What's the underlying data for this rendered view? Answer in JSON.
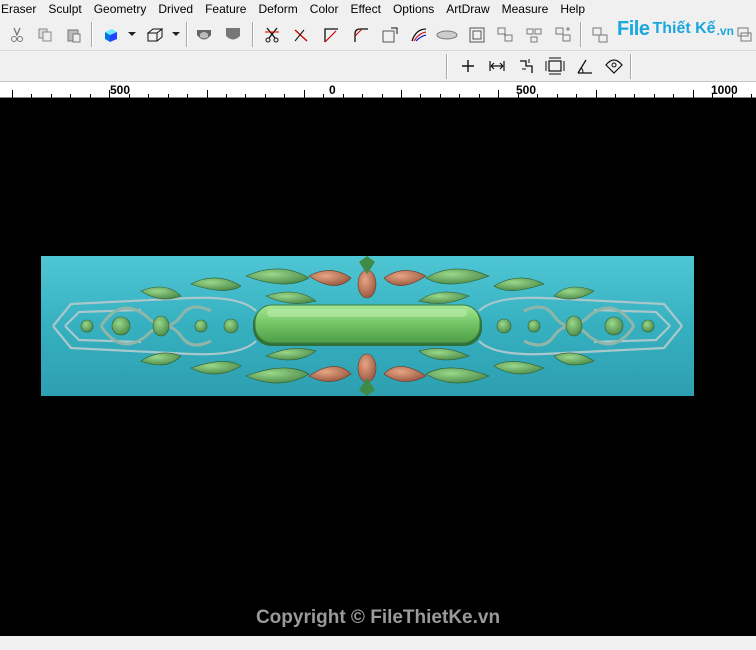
{
  "menu": [
    "Eraser",
    "Sculpt",
    "Geometry",
    "Drived",
    "Feature",
    "Deform",
    "Color",
    "Effect",
    "Options",
    "ArtDraw",
    "Measure",
    "Help"
  ],
  "logo": {
    "file": "File",
    "rest": "Thiết Kế",
    "tld": ".vn"
  },
  "ruler": {
    "labels": [
      "500",
      "0",
      "500",
      "1000"
    ]
  },
  "copyright": "Copyright © FileThietKe.vn",
  "colors": {
    "background": "#000000",
    "panel_cyan": "#3fb8c6",
    "ornament_green": "#5cae5c",
    "ornament_copper": "#c07858",
    "cartouche_green": "#7ccc6c"
  },
  "toolbar1_icons": [
    "cut-icon",
    "copy-icon",
    "paste-icon",
    "color-cube-icon",
    "wireframe-cube-icon",
    "dome-icon",
    "shield-icon",
    "scissors-curve-icon",
    "line-tool-icon",
    "corner-icon",
    "corner-round-icon",
    "box-corner-icon",
    "arc-tool-icon",
    "ellipse-icon",
    "frame-icon",
    "group-icon",
    "ungroup-icon",
    "align-icon",
    "duplicate-icon",
    "layer-icon"
  ],
  "toolbar2_icons": [
    "crosshair-icon",
    "measure-distance-icon",
    "measure-step-icon",
    "measure-box-icon",
    "measure-angle-icon",
    "measure-radius-icon"
  ]
}
